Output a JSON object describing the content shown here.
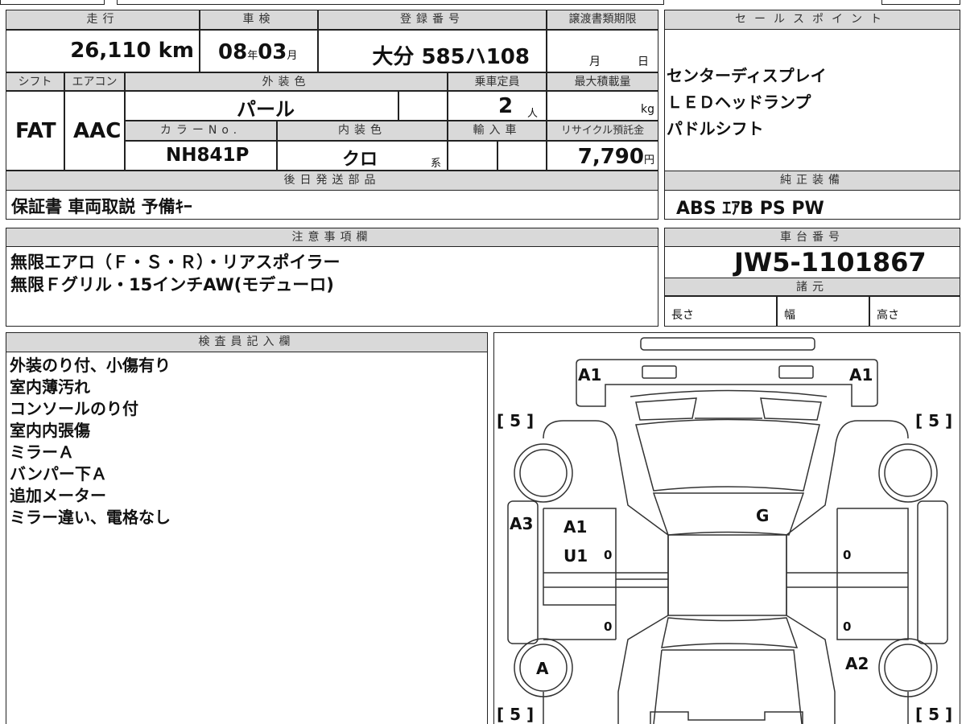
{
  "vehicle": {
    "mileage_label": "走行",
    "mileage_value": "26,110",
    "mileage_unit": "km",
    "inspection_label": "車検",
    "inspection_year": "08",
    "year_unit": "年",
    "inspection_month": "03",
    "month_unit": "月",
    "registration_label": "登録番号",
    "registration_value": "大分 585ハ108",
    "transfer_deadline_label": "譲渡書類期限",
    "transfer_month": "月",
    "transfer_day": "日",
    "shift_label": "シフト",
    "shift_value": "FAT",
    "ac_label": "エアコン",
    "ac_value": "AAC",
    "exterior_color_label": "外装色",
    "exterior_color_value": "パール",
    "capacity_label": "乗車定員",
    "capacity_value": "2",
    "capacity_unit": "人",
    "max_load_label": "最大積載量",
    "max_load_unit": "kg",
    "color_no_label": "カラーNo.",
    "color_no_value": "NH841P",
    "interior_color_label": "内装色",
    "interior_color_value": "クロ",
    "interior_color_suffix": "系",
    "import_label": "輸入車",
    "recycle_label": "リサイクル預託金",
    "recycle_value": "7,790",
    "recycle_unit": "円",
    "later_parts_label": "後日発送部品",
    "later_parts_value": "保証書 車両取説 予備ｷｰ"
  },
  "sales_points": {
    "label": "セールスポイント",
    "items": [
      "センターディスプレイ",
      "ＬＥＤヘッドランプ",
      "パドルシフト"
    ]
  },
  "equipment": {
    "label": "純正装備",
    "value": "ABS ｴｱB PS PW"
  },
  "notes": {
    "label": "注意事項欄",
    "lines": [
      "無限エアロ（Ｆ・Ｓ・Ｒ）・リアスポイラー",
      "無限Ｆグリル・15インチAW(モデューロ)"
    ]
  },
  "chassis": {
    "label": "車台番号",
    "value": "JW5-1101867",
    "spec_label": "諸元",
    "length": "長さ",
    "width": "幅",
    "height": "高さ"
  },
  "inspector": {
    "label": "検査員記入欄",
    "lines": [
      "外装のり付、小傷有り",
      "室内薄汚れ",
      "コンソールのり付",
      "室内内張傷",
      "ミラーＡ",
      "バンパー下Ａ",
      "追加メーター",
      "ミラー違い、電格なし"
    ]
  },
  "diagram": {
    "front_left": "A1",
    "front_right": "A1",
    "tire": "[ 5 ]",
    "left_fender": "A3",
    "front_left_door_1": "A1",
    "front_left_door_2": "U1",
    "roof": "G",
    "rear_left_wheel": "A",
    "rear_right": "A2",
    "door_mark": "0"
  }
}
